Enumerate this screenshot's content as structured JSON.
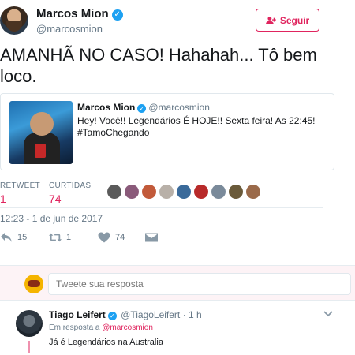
{
  "main_tweet": {
    "author": {
      "name": "Marcos Mion",
      "handle": "@marcosmion"
    },
    "follow_label": "Seguir",
    "text": "AMANHÃ NO CASO! Hahahah... Tô bem loco.",
    "quoted": {
      "name": "Marcos Mion",
      "handle": "@marcosmion",
      "text": "Hey! Você!! Legendários É HOJE!! Sexta feira! As 22:45! #TamoChegando"
    },
    "stats": {
      "retweets_label": "RETWEET",
      "retweets_value": "1",
      "likes_label": "CURTIDAS",
      "likes_value": "74"
    },
    "timestamp": "12:23 - 1 de jun de 2017",
    "actions": {
      "reply_count": "15",
      "retweet_count": "1",
      "like_count": "74"
    }
  },
  "reply_box": {
    "placeholder": "Tweete sua resposta"
  },
  "reply_tweet": {
    "name": "Tiago Leifert",
    "handle": "@TiagoLeifert",
    "time": "1 h",
    "in_reply_prefix": "Em resposta a",
    "in_reply_mention": "@marcosmion",
    "text": "Já é Legendários na Australia"
  },
  "colors": {
    "accent": "#e0245e",
    "verified": "#1da1f2",
    "muted": "#657786",
    "reply_bg": "#fdf3f6"
  }
}
